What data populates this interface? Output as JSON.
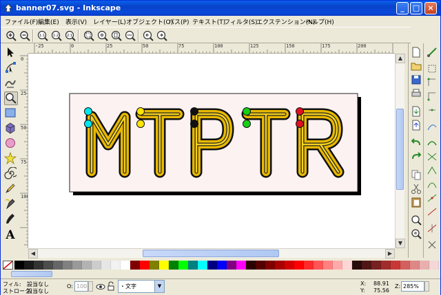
{
  "window": {
    "title": "banner07.svg - Inkscape"
  },
  "menu": [
    "ファイル(F)",
    "編集(E)",
    "表示(V)",
    "レイヤー(L)",
    "オブジェクト(O)",
    "パス(P)",
    "テキスト(T)",
    "フィルタ(S)",
    "エクステンション(N)",
    "ヘルプ(H)"
  ],
  "toolbar": {
    "zoom_tools": [
      "zoom-in-icon",
      "zoom-out-icon",
      "zoom-1-1-icon",
      "zoom-1-2-icon",
      "zoom-2-1-icon",
      "zoom-selection-icon",
      "zoom-drawing-icon",
      "zoom-page-icon",
      "zoom-page-width-icon",
      "zoom-previous-icon",
      "zoom-next-icon"
    ]
  },
  "ruler": {
    "h_labels": [
      "-25",
      "0",
      "25",
      "50",
      "75",
      "100",
      "125",
      "150",
      "175",
      "200"
    ],
    "v_labels": [
      "0",
      "25",
      "50",
      "75",
      "100"
    ]
  },
  "artwork": {
    "text": "MTPTR",
    "dot_colors": [
      "#00E5EE",
      "#FFE600",
      "#111111",
      "#18D018",
      "#E01020"
    ]
  },
  "palette": [
    "#000000",
    "#1a1a1a",
    "#333333",
    "#4d4d4d",
    "#666666",
    "#808080",
    "#999999",
    "#b3b3b3",
    "#cccccc",
    "#e6e6e6",
    "#f2f2f2",
    "#ffffff",
    "#800000",
    "#ff0000",
    "#808000",
    "#ffff00",
    "#008000",
    "#00ff00",
    "#008080",
    "#00ffff",
    "#000080",
    "#0000ff",
    "#800080",
    "#ff00ff",
    "#2b0000",
    "#550000",
    "#800000",
    "#aa0000",
    "#d40000",
    "#ff0000",
    "#ff2a2a",
    "#ff5555",
    "#ff8080",
    "#ffaaaa",
    "#ffd5d5",
    "#280b0b",
    "#501616",
    "#782121",
    "#a02c2c",
    "#c83737",
    "#d35f5f",
    "#de8787",
    "#e9afaf",
    "#f4d7d7"
  ],
  "status": {
    "fill_label": "フィル:",
    "fill_value": "設当なし",
    "stroke_label": "ストローク:",
    "stroke_value": "設当なし",
    "opacity_label": "O:",
    "opacity_value": "100",
    "layer_value": "文字",
    "x_label": "X:",
    "x_value": "88.91",
    "y_label": "Y:",
    "y_value": "75.56",
    "zoom_label": "Z:",
    "zoom_value": "285%"
  }
}
